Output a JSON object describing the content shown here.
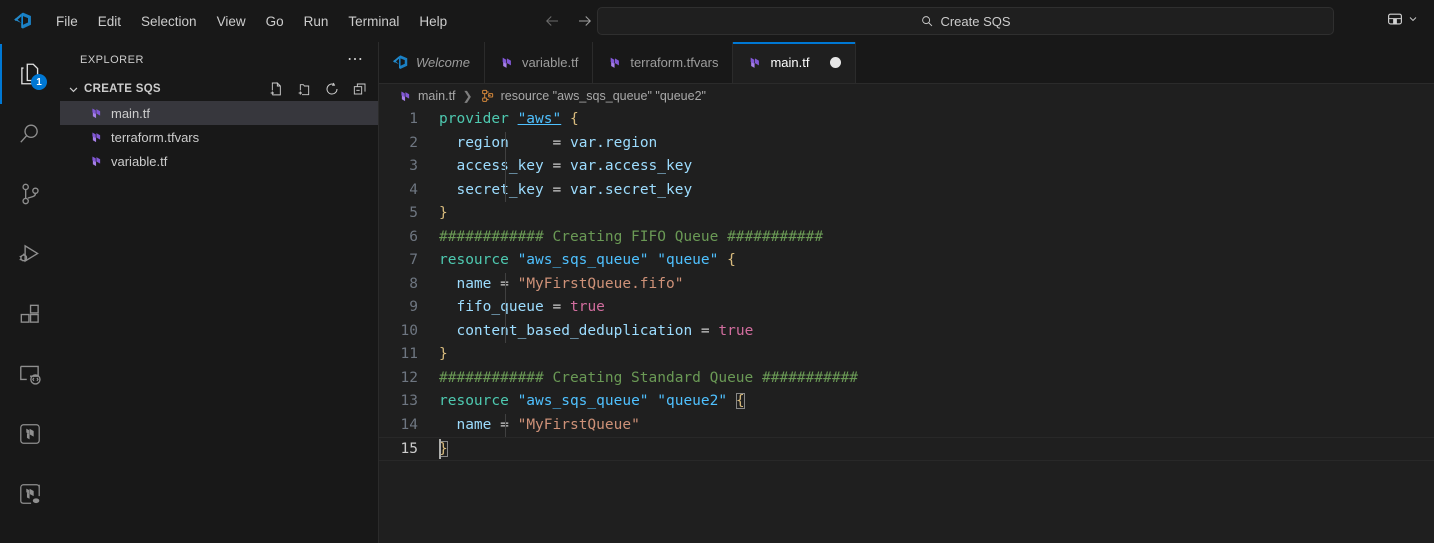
{
  "window": {
    "logo_icon": "vscode-logo-icon"
  },
  "menubar": {
    "items": [
      {
        "label": "File"
      },
      {
        "label": "Edit"
      },
      {
        "label": "Selection"
      },
      {
        "label": "View"
      },
      {
        "label": "Go"
      },
      {
        "label": "Run"
      },
      {
        "label": "Terminal"
      },
      {
        "label": "Help"
      }
    ]
  },
  "navigation": {
    "back_icon": "arrow-left-icon",
    "forward_icon": "arrow-right-icon"
  },
  "command_center": {
    "search_icon": "search-icon",
    "value": "Create SQS",
    "placeholder": "Search"
  },
  "layout_control": {
    "icon": "layout-panel-icon",
    "chevron_icon": "chevron-down-icon"
  },
  "activitybar": {
    "items": [
      {
        "name": "explorer",
        "icon": "files-icon",
        "badge": "1",
        "active": true
      },
      {
        "name": "search",
        "icon": "search-icon",
        "badge": "",
        "active": false
      },
      {
        "name": "source-control",
        "icon": "source-control-icon",
        "badge": "",
        "active": false
      },
      {
        "name": "run-and-debug",
        "icon": "run-debug-icon",
        "badge": "",
        "active": false
      },
      {
        "name": "extensions",
        "icon": "extensions-icon",
        "badge": "",
        "active": false
      },
      {
        "name": "remote-explorer",
        "icon": "remote-explorer-icon",
        "badge": "",
        "active": false
      },
      {
        "name": "terraform",
        "icon": "terraform-icon",
        "badge": "",
        "active": false
      },
      {
        "name": "terraform-cloud",
        "icon": "terraform-cloud-icon",
        "badge": "",
        "active": false
      }
    ]
  },
  "sidebar": {
    "title": "EXPLORER",
    "more_actions_icon": "ellipsis-icon",
    "folder": {
      "name": "CREATE SQS",
      "chevron_icon": "chevron-down-icon",
      "expanded": true,
      "actions": [
        {
          "name": "new-file",
          "icon": "new-file-icon"
        },
        {
          "name": "new-folder",
          "icon": "new-folder-icon"
        },
        {
          "name": "refresh-explorer",
          "icon": "refresh-icon"
        },
        {
          "name": "collapse-folders",
          "icon": "collapse-all-icon"
        }
      ]
    },
    "files": [
      {
        "name": "main.tf",
        "icon": "terraform-file-icon",
        "selected": true
      },
      {
        "name": "terraform.tfvars",
        "icon": "terraform-file-icon",
        "selected": false
      },
      {
        "name": "variable.tf",
        "icon": "terraform-file-icon",
        "selected": false
      }
    ]
  },
  "tabs": [
    {
      "label": "Welcome",
      "icon": "vscode-logo-icon",
      "active": false,
      "italic": true,
      "dirty": false
    },
    {
      "label": "variable.tf",
      "icon": "terraform-file-icon",
      "active": false,
      "italic": false,
      "dirty": false
    },
    {
      "label": "terraform.tfvars",
      "icon": "terraform-file-icon",
      "active": false,
      "italic": false,
      "dirty": false
    },
    {
      "label": "main.tf",
      "icon": "terraform-file-icon",
      "active": true,
      "italic": false,
      "dirty": true
    }
  ],
  "breadcrumb": {
    "file_icon": "terraform-file-icon",
    "file": "main.tf",
    "separator": "❯",
    "symbol_icon": "symbol-structure-icon",
    "symbol": "resource \"aws_sqs_queue\" \"queue2\""
  },
  "editor": {
    "filename": "main.tf",
    "language": "terraform",
    "cursor_line": 15,
    "cursor_column": 2,
    "total_lines": 15,
    "colors": {
      "background": "#1f1f1f",
      "accent": "#0078d4",
      "keyword": "#4ec9b0",
      "string": "#4fc1ff",
      "simple_string": "#ce9178",
      "comment": "#6a9955",
      "boolean": "#d16d9e",
      "brace": "#d7ba7d",
      "property": "#9cdcfe"
    },
    "lines": [
      {
        "n": "1",
        "text": "provider \"aws\" {"
      },
      {
        "n": "2",
        "text": "  region     = var.region"
      },
      {
        "n": "3",
        "text": "  access_key = var.access_key"
      },
      {
        "n": "4",
        "text": "  secret_key = var.secret_key"
      },
      {
        "n": "5",
        "text": "}"
      },
      {
        "n": "6",
        "text": "############ Creating FIFO Queue ###########"
      },
      {
        "n": "7",
        "text": "resource \"aws_sqs_queue\" \"queue\" {"
      },
      {
        "n": "8",
        "text": "  name = \"MyFirstQueue.fifo\""
      },
      {
        "n": "9",
        "text": "  fifo_queue = true"
      },
      {
        "n": "10",
        "text": "  content_based_deduplication = true"
      },
      {
        "n": "11",
        "text": "}"
      },
      {
        "n": "12",
        "text": "############ Creating Standard Queue ###########"
      },
      {
        "n": "13",
        "text": "resource \"aws_sqs_queue\" \"queue2\" {"
      },
      {
        "n": "14",
        "text": "  name = \"MyFirstQueue\""
      },
      {
        "n": "15",
        "text": "}"
      }
    ]
  }
}
